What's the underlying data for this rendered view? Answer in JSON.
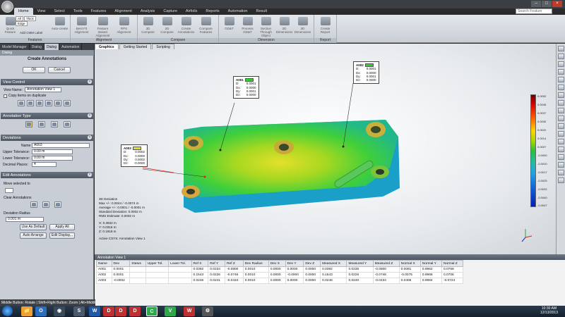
{
  "ribbon": {
    "tabs": [
      "Home",
      "View",
      "Select",
      "Tools",
      "Features",
      "Alignment",
      "Analysis",
      "Capture",
      "Airfoils",
      "Reports",
      "Automation",
      "Result"
    ],
    "search_placeholder": "Search Feature",
    "feature_chips": [
      "All",
      "Thick",
      "Edge"
    ],
    "groups": [
      {
        "label": "Features",
        "buttons": [
          "Quick Feature",
          "Auto-create",
          "Add CMM Label"
        ]
      },
      {
        "label": "Alignment",
        "buttons": [
          "Best Fit Alignment",
          "Feature Based Alignment",
          "RPS Alignment"
        ]
      },
      {
        "label": "Compare",
        "buttons": [
          "3D Compare",
          "2D Compare",
          "Create Annotations",
          "Compare Features"
        ]
      },
      {
        "label": "Dimension",
        "buttons": [
          "GD&T",
          "Process GD&T",
          "Section Through Object",
          "2D Dimensions",
          "3D Dimensions"
        ]
      },
      {
        "label": "Report",
        "buttons": [
          "Create Report"
        ]
      }
    ]
  },
  "panel": {
    "tabs": [
      "Model Manager",
      "Dialog",
      "Dialog",
      "Automation"
    ],
    "title": "Dialog",
    "dialog_title": "Create Annotations",
    "ok": "OK",
    "cancel": "Cancel",
    "view_control": {
      "head": "View Control",
      "view_name_label": "View Name:",
      "view_name": "Annotation View 1",
      "copy_label": "Copy items on duplicate"
    },
    "annotation_type": {
      "head": "Annotation Type"
    },
    "deviations": {
      "head": "Deviations",
      "name_label": "Name",
      "name": "A003",
      "upper_label": "Upper Tolerance:",
      "upper": "0.00 m",
      "lower_label": "Lower Tolerance:",
      "lower": "0.00 m",
      "decimal_label": "Decimal Places:",
      "decimal": "4"
    },
    "edit": {
      "head": "Edit Annotations",
      "move_label": "Move selected to",
      "clear_label": "Clear Annotations",
      "radius_label": "Deviation Radius",
      "radius": "0.001 m",
      "use_default": "Use As Default",
      "apply_all": "Apply All",
      "auto_arrange": "Auto Arrange",
      "edit_display": "Edit Display..."
    }
  },
  "viewport": {
    "tabs": [
      "Graphics",
      "Getting Started",
      "Scripting"
    ],
    "callouts": [
      {
        "id": "A001",
        "color": "#33cc33",
        "D": "0.0001",
        "Dx": "0.0000",
        "Dy": "0.0001",
        "Dz": "0.0000"
      },
      {
        "id": "A002",
        "color": "#33cc33",
        "D": "0.0001",
        "Dx": "0.0000",
        "Dy": "0.0001",
        "Dz": "0.0000"
      },
      {
        "id": "A003",
        "color": "#e0e020",
        "D": "0.0002",
        "Dx": "0.0000",
        "Dy": "0.0002",
        "Dz": "-0.0000"
      }
    ],
    "scale_labels": [
      "0.0052",
      "0.0045",
      "0.0037",
      "0.0030",
      "0.0022",
      "0.0014",
      "0.0007",
      "-0.0000",
      "-0.0010",
      "-0.0017",
      "-0.0025",
      "-0.0032",
      "-0.0040",
      "-0.0047"
    ],
    "deviation_info": [
      "3D Deviation",
      "Max +/-: 0.0044 / -0.0074 m",
      "Average +/-: 0.0001 / -0.0001 m",
      "Standard Deviation: 0.0002 m",
      "RMS Estimate: 0.0002 m",
      "",
      "X: 0.2832 m",
      "Y: 0.0318 m",
      "Z: 0.1918 m",
      "",
      "Active CSYS: Annotation View 1"
    ]
  },
  "annotation_table": {
    "title": "Annotation View 1",
    "headers": [
      "Name",
      "Dev",
      "Status",
      "Upper Tol.",
      "Lower Tol.",
      "Ref X",
      "Ref Y",
      "Ref Z",
      "Dev Radius",
      "Dev X",
      "Dev Y",
      "Dev Z",
      "Measured X",
      "Measured Y",
      "Measured Z",
      "Normal X",
      "Normal Y",
      "Normal Z"
    ],
    "rows": [
      [
        "A001",
        "0.0001",
        "",
        "",
        "",
        "0.0392",
        "0.0234",
        "-0.0800",
        "0.0010",
        "0.0000",
        "0.0000",
        "0.0000",
        "0.0392",
        "0.0235",
        "-0.0800",
        "0.0081",
        "0.9962",
        "0.0769"
      ],
      [
        "A002",
        "0.0001",
        "",
        "",
        "",
        "0.1543",
        "0.0226",
        "-0.0746",
        "0.0010",
        "0.0000",
        "-0.0000",
        "0.0000",
        "0.1543",
        "0.0226",
        "-0.0746",
        "-0.0075",
        "0.9968",
        "0.0706"
      ],
      [
        "A003",
        "-0.0002",
        "",
        "",
        "",
        "0.0246",
        "0.0241",
        "-0.0434",
        "0.0010",
        "0.0000",
        "0.0000",
        "0.0000",
        "0.0246",
        "0.0240",
        "-0.0434",
        "0.0405",
        "0.9984",
        "-0.0724"
      ]
    ]
  },
  "status_text": "Middle Button: Rotate | Shift+Right Button: Zoom | Alt+Middle Button: Pan",
  "taskbar": {
    "time": "10:30 AM",
    "date": "12/13/2013"
  }
}
